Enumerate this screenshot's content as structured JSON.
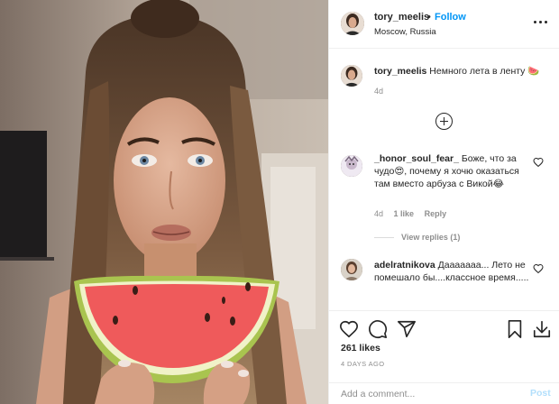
{
  "post": {
    "username": "tory_meelis",
    "follow_label": "Follow",
    "separator": "•",
    "location": "Moscow, Russia"
  },
  "caption": {
    "username": "tory_meelis",
    "text": "Немного лета в ленту 🍉",
    "time": "4d"
  },
  "comments": [
    {
      "username": "_honor_soul_fear_",
      "text": "Боже, что за чудо😍, почему я хочю оказаться там вместо арбуза с Викой😂",
      "time": "4d",
      "likes": "1 like",
      "reply_label": "Reply",
      "view_replies": "View replies (1)"
    },
    {
      "username": "adelratnikova",
      "text": "Дааааааа... Лето не помешало бы....классное время.....",
      "time": "",
      "likes": "",
      "reply_label": ""
    }
  ],
  "actions": {
    "likes": "261 likes",
    "time_ago": "4 DAYS AGO"
  },
  "composer": {
    "placeholder": "Add a comment...",
    "post_label": "Post"
  },
  "colors": {
    "accent": "#0095f6",
    "post_disabled": "#b2dffc",
    "text": "#262626",
    "muted": "#8e8e8e"
  },
  "icons": {
    "header_more": "more-horizontal-icon",
    "load_more": "plus-circle-icon",
    "like": "heart-icon",
    "comment": "comment-icon",
    "share": "paper-plane-icon",
    "save": "bookmark-icon",
    "download": "download-icon"
  }
}
